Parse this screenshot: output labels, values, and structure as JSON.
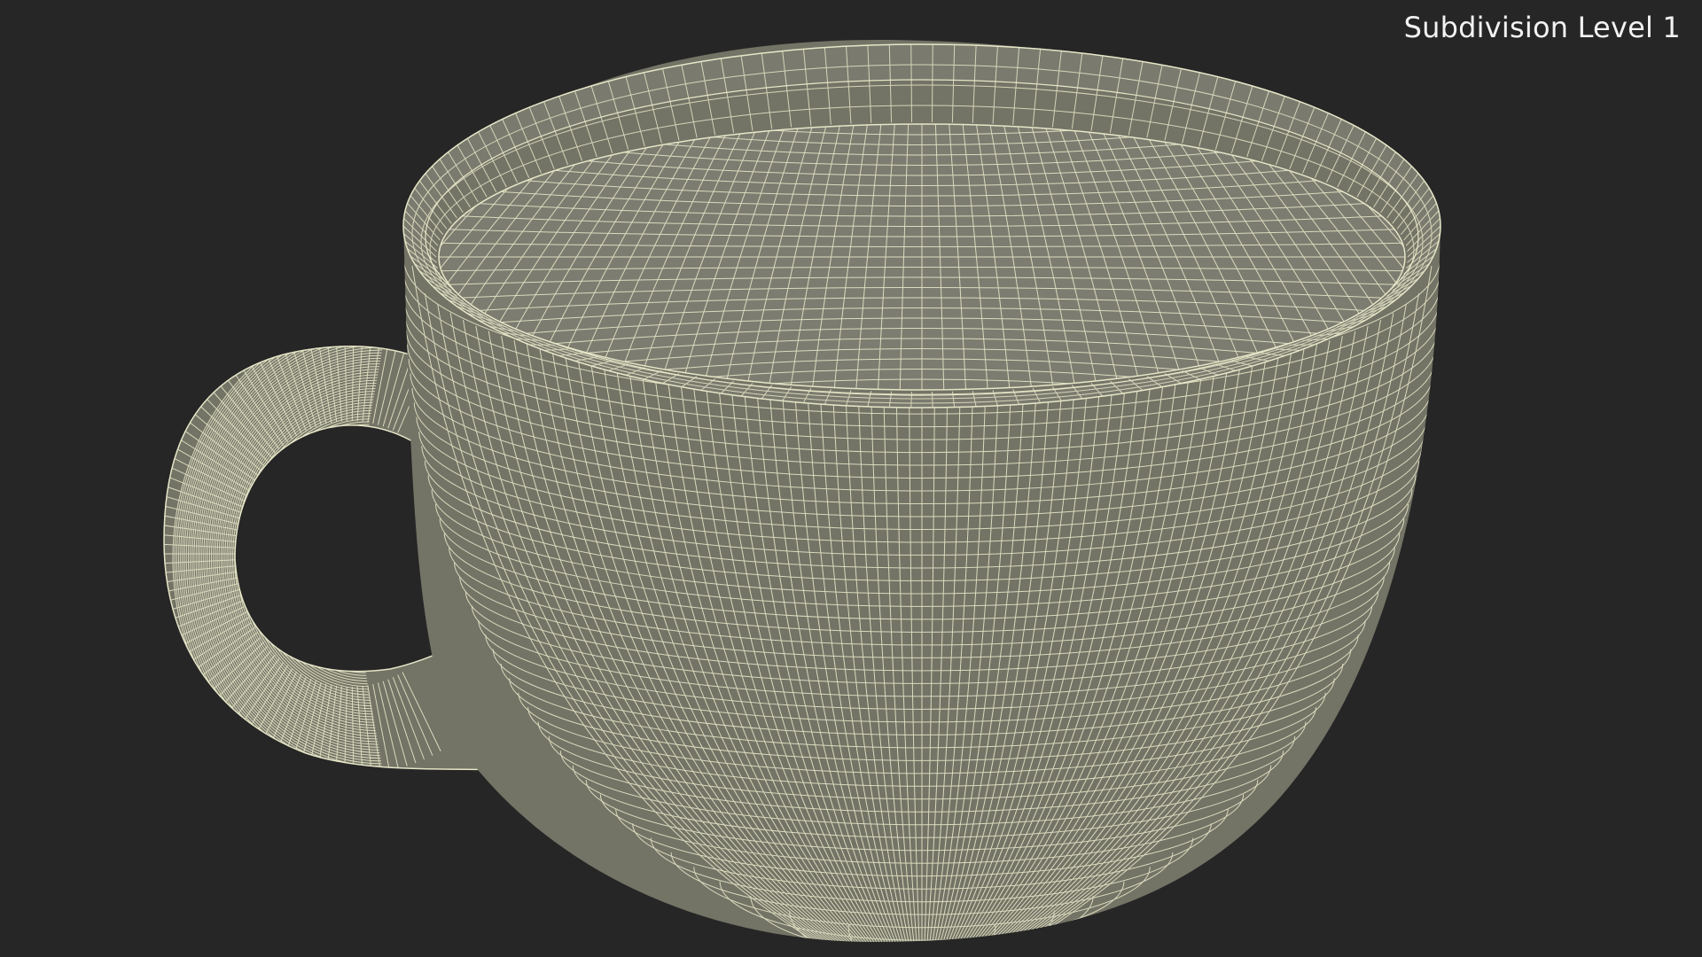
{
  "viewport": {
    "overlay_label": "Subdivision Level 1",
    "subject": "teacup-wireframe"
  },
  "colors": {
    "background": "#262626",
    "surface": "#737366",
    "surface_inner": "#7c7c70",
    "wire": "#e6e6c8",
    "label": "#f2f2f2"
  }
}
